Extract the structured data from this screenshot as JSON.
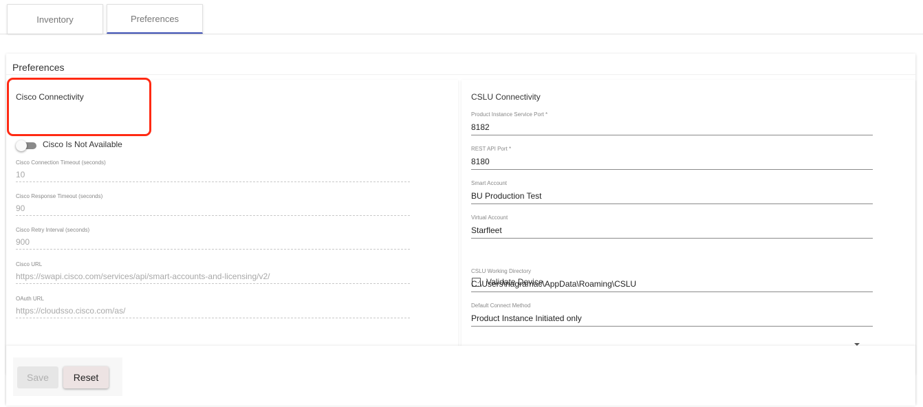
{
  "tabs": [
    {
      "label": "Inventory"
    },
    {
      "label": "Preferences"
    }
  ],
  "card": {
    "title": "Preferences"
  },
  "cisco": {
    "title": "Cisco Connectivity",
    "toggle_label": "Cisco Is Not Available",
    "toggle_on": false,
    "fields": [
      {
        "label": "Cisco Connection Timeout (seconds)",
        "value": "10"
      },
      {
        "label": "Cisco Response Timeout (seconds)",
        "value": "90"
      },
      {
        "label": "Cisco Retry Interval (seconds)",
        "value": "900"
      },
      {
        "label": "Cisco URL",
        "value": "https://swapi.cisco.com/services/api/smart-accounts-and-licensing/v2/"
      },
      {
        "label": "OAuth URL",
        "value": "https://cloudsso.cisco.com/as/"
      }
    ]
  },
  "cslu": {
    "title": "CSLU Connectivity",
    "fields": [
      {
        "label": "Product Instance Service Port *",
        "value": "8182"
      },
      {
        "label": "REST API Port *",
        "value": "8180"
      },
      {
        "label": "Smart Account",
        "value": "BU Production Test"
      },
      {
        "label": "Virtual Account",
        "value": "Starfleet"
      }
    ],
    "validate_device": {
      "label": "Validate Device",
      "checked": false
    },
    "working_directory": {
      "label": "CSLU Working Directory",
      "value": "C:\\Users\\nagramac\\AppData\\Roaming\\CSLU"
    },
    "connect_method": {
      "label": "Default Connect Method",
      "value": "Product Instance Initiated only"
    }
  },
  "footer": {
    "save_label": "Save",
    "reset_label": "Reset"
  },
  "colors": {
    "highlight": "#ff2a13",
    "tab_active_underline": "#3f51b5"
  }
}
